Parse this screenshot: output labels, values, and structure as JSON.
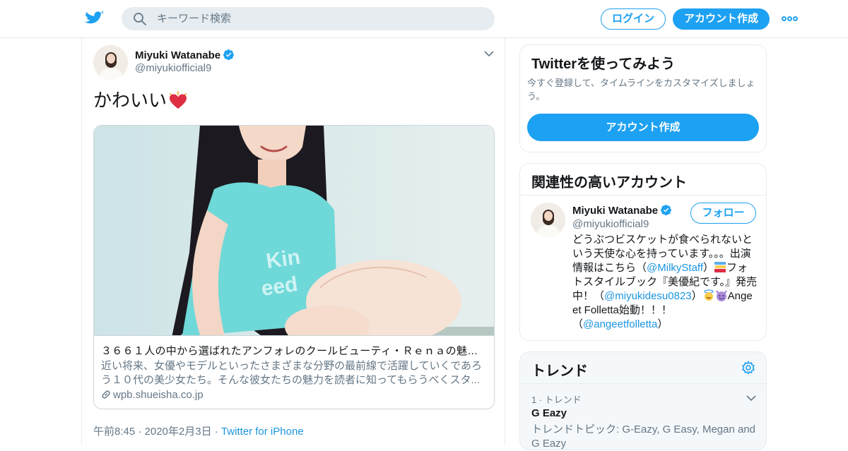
{
  "topbar": {
    "search_placeholder": "キーワード検索",
    "login_label": "ログイン",
    "signup_label": "アカウント作成"
  },
  "tweet": {
    "author_name": "Miyuki Watanabe",
    "author_handle": "@miyukiofficial9",
    "text": "かわいい",
    "card": {
      "title": "３６６１人の中から選ばれたアンフォレのクールビューティ・Ｒｅｎａの魅力...",
      "description": "近い将来、女優やモデルといったさまざまな分野の最前線で活躍していくであろう１０代の美少女たち。そんな彼女たちの魅力を読者に知ってもらうべくスタ...",
      "domain": "wpb.shueisha.co.jp"
    },
    "timestamp": "午前8:45 · 2020年2月3日 ·",
    "source": "Twitter for iPhone"
  },
  "signup_module": {
    "title": "Twitterを使ってみよう",
    "subtitle": "今すぐ登録して、タイムラインをカスタマイズしましょう。",
    "button_label": "アカウント作成"
  },
  "related_module": {
    "title": "関連性の高いアカウント",
    "account": {
      "name": "Miyuki Watanabe",
      "handle": "@miyukiofficial9",
      "follow_label": "フォロー",
      "bio": {
        "p1": "どうぶつビスケットが食べられないという天使な心を持っています。。。出演情報はこちら（",
        "m1": "@MilkyStaff",
        "p2": "）",
        "p3": "フォトスタイルブック『美優紀です。』発売中！（",
        "m2": "@miyukidesu0823",
        "p4": "）",
        "p5": "Ange et Folletta始動！！！（",
        "m3": "@angeetfolletta",
        "p6": "）"
      }
    }
  },
  "trends_module": {
    "title": "トレンド",
    "items": [
      {
        "meta": "1 · トレンド",
        "name": "G Eazy",
        "topics": "トレンドトピック: G-Eazy, G Easy, Megan and G Eazy"
      }
    ]
  },
  "colors": {
    "accent": "#1da1f2",
    "link": "#1b95e0",
    "secondary_text": "#657786",
    "border": "#e6ecf0"
  },
  "icons": [
    "twitter-bird-icon",
    "search-icon",
    "more-dots-icon",
    "verified-badge-icon",
    "chevron-down-icon",
    "heart-emoji-icon",
    "link-icon",
    "books-emoji-icon",
    "angel-emoji-icon",
    "devil-emoji-icon",
    "gear-icon"
  ]
}
